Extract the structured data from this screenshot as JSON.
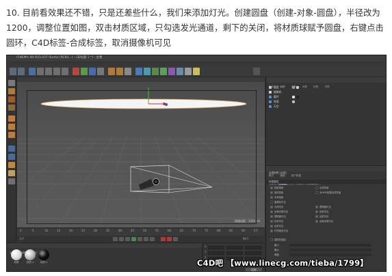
{
  "caption": {
    "text": "10. 目前看效果还不错，只是还差些什么，我们来添加灯光。创建圆盘（创建-对象-圆盘），半径改为1200，调整位置如图，双击材质区域，只勾选发光通道，剩下的关闭，将材质球赋予圆盘，右键点击圆环，C4D标签-合成标签，取消摄像机可见"
  },
  "app": {
    "title": "CINEMA 4D R15.037 Studio (RC83...) - [未标题 1 *] - 主要",
    "menu": [
      "文件",
      "编辑",
      "创建",
      "选择",
      "工具",
      "网格",
      "捕捉",
      "动画",
      "模拟",
      "渲染",
      "雕刻",
      "运动跟踪",
      "运动图形",
      "角色",
      "插件",
      "脚本",
      "窗口",
      "帮助"
    ]
  },
  "viewport": {
    "menu": [
      "查看",
      "摄像机",
      "显示",
      "选项",
      "过滤",
      "面板"
    ],
    "scale_label": "网格间距 : 1000 cm"
  },
  "timeline": {
    "ticks": [
      "0",
      "5",
      "10",
      "15",
      "20",
      "25",
      "30",
      "35",
      "40",
      "45",
      "50",
      "55",
      "60",
      "65",
      "70",
      "75",
      "80",
      "85",
      "90"
    ],
    "end_label": "0 F"
  },
  "transport": {
    "start": "0 F",
    "end": "90 F"
  },
  "materials": {
    "menu": [
      "创建",
      "编辑",
      "功能",
      "纹理"
    ],
    "items": [
      {
        "label": "材质",
        "color": "#d8d8d8"
      },
      {
        "label": "材质.1",
        "color": "#bcbcbc"
      },
      {
        "label": "材质.2",
        "color": "#111111"
      }
    ]
  },
  "coordinates": {
    "axes": [
      "X",
      "Y",
      "Z"
    ],
    "values_pos": [
      "0 cm",
      "0 cm",
      "0 cm"
    ],
    "values_size": [
      "0 cm",
      "0 cm",
      "0 cm"
    ],
    "values_rot": [
      "0 °",
      "0 °",
      "0 °"
    ],
    "apply_label": "应用"
  },
  "objects": {
    "menu": [
      "文件",
      "编辑",
      "查看",
      "对象",
      "标签",
      "书签"
    ],
    "rows": [
      {
        "name": "圆盘",
        "color": "#c8c8c8"
      },
      {
        "name": "摄像机",
        "color": "#d0d0d0"
      },
      {
        "name": "圆环",
        "color": "#5a8fd0"
      },
      {
        "name": "地面",
        "color": "#5a8fd0"
      },
      {
        "name": "天空",
        "color": "#5a8fd0"
      }
    ]
  },
  "attributes": {
    "menu": [
      "模式",
      "编辑",
      "用户数据"
    ],
    "header": "合成标签 [合成]",
    "tabs": [
      "基本",
      "标签",
      "GI",
      "排除",
      "对象缓存"
    ],
    "section": "标签属性",
    "left_options": [
      "投射投影",
      "接收投影",
      "本体投影",
      "摄像机可见",
      "光线可见",
      "全局光照可见",
      "透明度可见",
      "折射可见",
      "反射可见",
      "环境吸收可见"
    ],
    "right_options": [
      "合成背景",
      "为HDR贴图合成背景",
      "透明度可见",
      "折射可见",
      "反射可见",
      "全局光照可见"
    ],
    "camera_option_index": 3,
    "bottom_section": "强制抗锯齿",
    "bottom_fields": [
      "最小",
      "最大",
      "阈值"
    ],
    "matte": "蒙板对象"
  },
  "watermark": {
    "text": "C4D吧 【www.linecg.com/tieba/1799】"
  }
}
